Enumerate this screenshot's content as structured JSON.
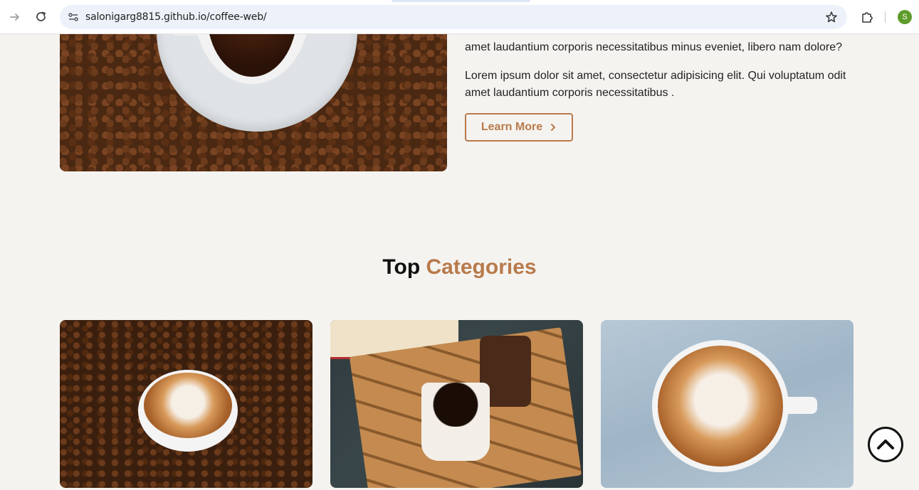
{
  "browser": {
    "url": "salonigarg8815.github.io/coffee-web/",
    "profile_initial": "S"
  },
  "about": {
    "paragraph_1_partial": "amet laudantium corporis necessitatibus minus eveniet, libero nam dolore?",
    "paragraph_2": "Lorem ipsum dolor sit amet, consectetur adipisicing elit. Qui voluptatum odit amet laudantium corporis necessitatibus .",
    "learn_more_label": "Learn More"
  },
  "categories": {
    "title_plain": "Top",
    "title_accent": "Categories"
  },
  "colors": {
    "accent": "#b87a4b",
    "page_background": "#f5f3f0"
  },
  "icons": {
    "back": "arrow-right-icon",
    "reload": "reload-icon",
    "site_info": "site-info-icon",
    "bookmark": "star-icon",
    "extensions": "puzzle-icon",
    "learn_more": "chevron-right-icon",
    "scroll_top": "chevron-up-icon"
  }
}
